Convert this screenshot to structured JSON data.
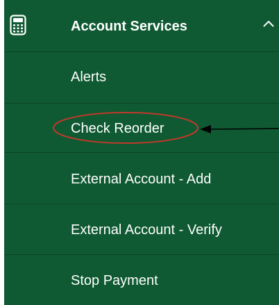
{
  "menu": {
    "header": {
      "label": "Account Services",
      "icon": "calculator-icon",
      "toggle_icon": "chevron-up-icon",
      "expanded": true
    },
    "items": [
      {
        "label": "Alerts"
      },
      {
        "label": "Check Reorder",
        "highlighted": true
      },
      {
        "label": "External Account - Add"
      },
      {
        "label": "External Account - Verify"
      },
      {
        "label": "Stop Payment"
      }
    ]
  },
  "colors": {
    "menu_background": "#0f5a32",
    "divider": "#0a4426",
    "text": "#ffffff",
    "highlight_ellipse": "#c0392b",
    "annotation_arrow": "#000000"
  }
}
